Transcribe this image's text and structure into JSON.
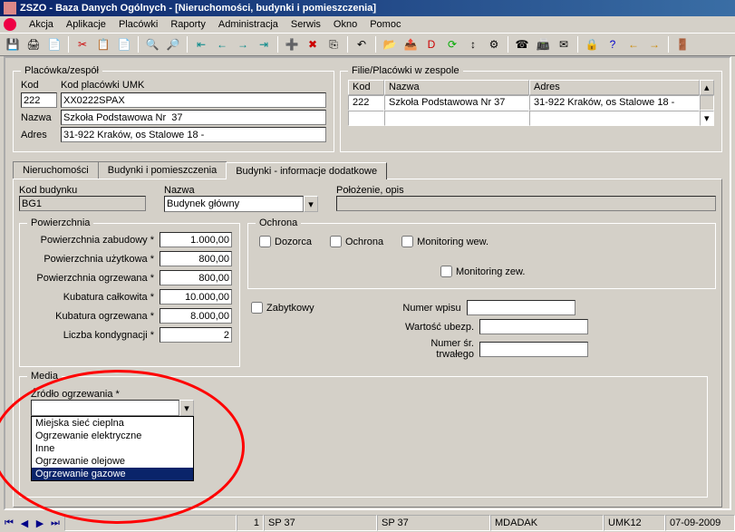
{
  "window": {
    "title": "ZSZO - Baza Danych Ogólnych - [Nieruchomości, budynki i pomieszczenia]"
  },
  "menu": [
    "Akcja",
    "Aplikacje",
    "Placówki",
    "Raporty",
    "Administracja",
    "Serwis",
    "Okno",
    "Pomoc"
  ],
  "placowka": {
    "legend": "Placówka/zespół",
    "kod_h": "Kod",
    "kodumk_h": "Kod placówki UMK",
    "kod": "222",
    "kodumk": "XX0222SPAX",
    "nazwa_l": "Nazwa",
    "nazwa": "Szkoła Podstawowa Nr  37",
    "adres_l": "Adres",
    "adres": "31-922 Kraków, os Stalowe 18 -"
  },
  "filie": {
    "legend": "Filie/Placówki w zespole",
    "kod_h": "Kod",
    "nazwa_h": "Nazwa",
    "adres_h": "Adres",
    "kod": "222",
    "nazwa": "Szkoła Podstawowa Nr  37",
    "adres": "31-922 Kraków, os Stalowe 18 -"
  },
  "tabs": [
    "Nieruchomości",
    "Budynki i pomieszczenia",
    "Budynki - informacje dodatkowe"
  ],
  "budynek": {
    "kod_l": "Kod budynku",
    "kod": "BG1",
    "nazwa_l": "Nazwa",
    "nazwa": "Budynek główny",
    "polozenie_l": "Położenie, opis",
    "polozenie": ""
  },
  "pow": {
    "legend": "Powierzchnia",
    "zab_l": "Powierzchnia zabudowy *",
    "zab": "1.000,00",
    "uzy_l": "Powierzchnia użytkowa *",
    "uzy": "800,00",
    "ogr_l": "Powierzchnia ogrzewana *",
    "ogr": "800,00",
    "kub_l": "Kubatura całkowita *",
    "kub": "10.000,00",
    "kubogr_l": "Kubatura ogrzewana *",
    "kubogr": "8.000,00",
    "kond_l": "Liczba kondygnacji *",
    "kond": "2"
  },
  "ochrona": {
    "legend": "Ochrona",
    "doz": "Dozorca",
    "och": "Ochrona",
    "monw": "Monitoring wew.",
    "monz": "Monitoring zew."
  },
  "extra": {
    "zab_l": "Zabytkowy",
    "nrwp_l": "Numer wpisu",
    "wart_l": "Wartość ubezp.",
    "nrsr_l": "Numer śr. trwałego"
  },
  "media": {
    "legend": "Media",
    "src_l": "Źródło ogrzewania *",
    "options": [
      "Miejska sieć cieplna",
      "Ogrzewanie elektryczne",
      "Inne",
      "Ogrzewanie olejowe",
      "Ogrzewanie gazowe"
    ],
    "selected": 4
  },
  "status": {
    "rec": "1",
    "s1": "SP 37",
    "s2": "SP 37",
    "user": "MDADAK",
    "sys": "UMK12",
    "date": "07-09-2009"
  }
}
